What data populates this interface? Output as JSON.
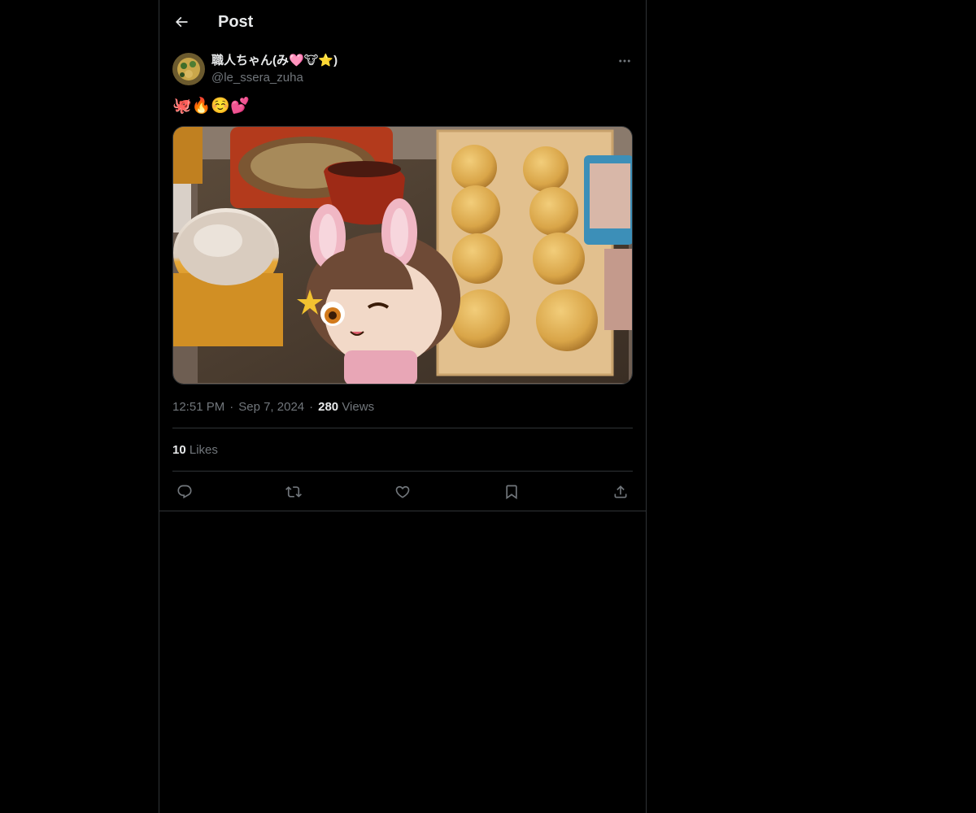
{
  "header": {
    "title": "Post",
    "back_icon": "arrow-left-icon"
  },
  "post": {
    "author": {
      "display_name": "職人ちゃん(み🩷🐮⭐)",
      "handle": "@le_ssera_zuha"
    },
    "more_icon": "more-horizontal-icon",
    "text": "🐙🔥☺️💕",
    "media": {
      "icon": "photo-image"
    },
    "time": "12:51 PM",
    "date": "Sep 7, 2024",
    "views_count": "280",
    "views_label": "Views",
    "likes_count": "10",
    "likes_label": "Likes",
    "actions": [
      {
        "name": "reply",
        "icon": "reply-icon"
      },
      {
        "name": "repost",
        "icon": "repost-icon"
      },
      {
        "name": "like",
        "icon": "heart-icon"
      },
      {
        "name": "bookmark",
        "icon": "bookmark-icon"
      },
      {
        "name": "share",
        "icon": "share-icon"
      }
    ]
  },
  "colors": {
    "background": "#000000",
    "border": "#2f3336",
    "text_primary": "#e7e9ea",
    "text_secondary": "#71767b"
  }
}
